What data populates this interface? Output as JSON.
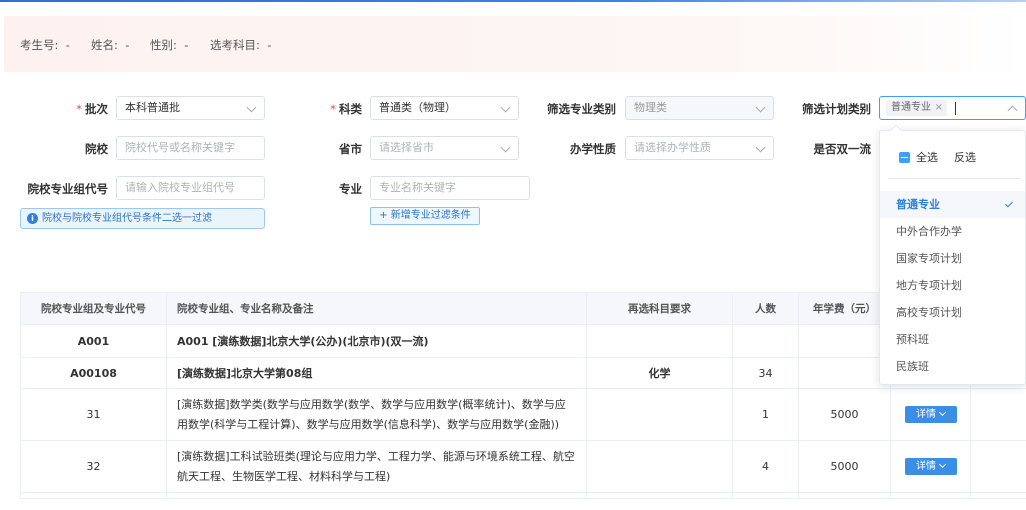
{
  "info": {
    "candidate_no_label": "考生号:",
    "candidate_no_value": "-",
    "name_label": "姓名:",
    "name_value": "-",
    "gender_label": "性别:",
    "gender_value": "-",
    "subjects_label": "选考科目:",
    "subjects_value": "-"
  },
  "filters": {
    "batch_label": "批次",
    "batch_value": "本科普通批",
    "category_label": "科类",
    "category_value": "普通类（物理）",
    "major_type_label": "筛选专业类别",
    "major_type_value": "物理类",
    "plan_type_label": "筛选计划类别",
    "plan_type_tag": "普通专业",
    "school_label": "院校",
    "school_placeholder": "院校代号或名称关键字",
    "province_label": "省市",
    "province_placeholder": "请选择省市",
    "nature_label": "办学性质",
    "nature_placeholder": "请选择办学性质",
    "double_first_label": "是否双一流",
    "group_code_label": "院校专业组代号",
    "group_code_placeholder": "请输入院校专业组代号",
    "major_label": "专业",
    "major_placeholder": "专业名称关键字",
    "add_filter_label": "+ 新增专业过滤条件",
    "notice": "院校与院校专业组代号条件二选一过滤"
  },
  "dropdown": {
    "select_all": "全选",
    "invert": "反选",
    "options": [
      "普通专业",
      "中外合作办学",
      "国家专项计划",
      "地方专项计划",
      "高校专项计划",
      "预科班",
      "民族班"
    ],
    "selected_index": 0
  },
  "table": {
    "headers": [
      "院校专业组及专业代号",
      "院校专业组、专业名称及备注",
      "再选科目要求",
      "人数",
      "年学费（元）",
      "",
      ""
    ],
    "rows": [
      {
        "code": "A001",
        "name": "A001 [演练数据]北京大学(公办)(北京市)(双一流)",
        "req": "",
        "count": "",
        "fee": ""
      },
      {
        "code": "A00108",
        "name": "[演练数据]北京大学第08组",
        "req": "化学",
        "count": "34",
        "fee": ""
      },
      {
        "code": "31",
        "name": "[演练数据]数学类(数学与应用数学(数学、数学与应用数学(概率统计)、数学与应用数学(科学与工程计算)、数学与应用数学(信息科学)、数学与应用数学(金融))",
        "req": "",
        "count": "1",
        "fee": "5000",
        "action": "详情"
      },
      {
        "code": "32",
        "name": "[演练数据]工科试验班类(理论与应用力学、工程力学、能源与环境系统工程、航空航天工程、生物医学工程、材料科学与工程)",
        "req": "",
        "count": "4",
        "fee": "5000",
        "action": "详情"
      }
    ]
  }
}
